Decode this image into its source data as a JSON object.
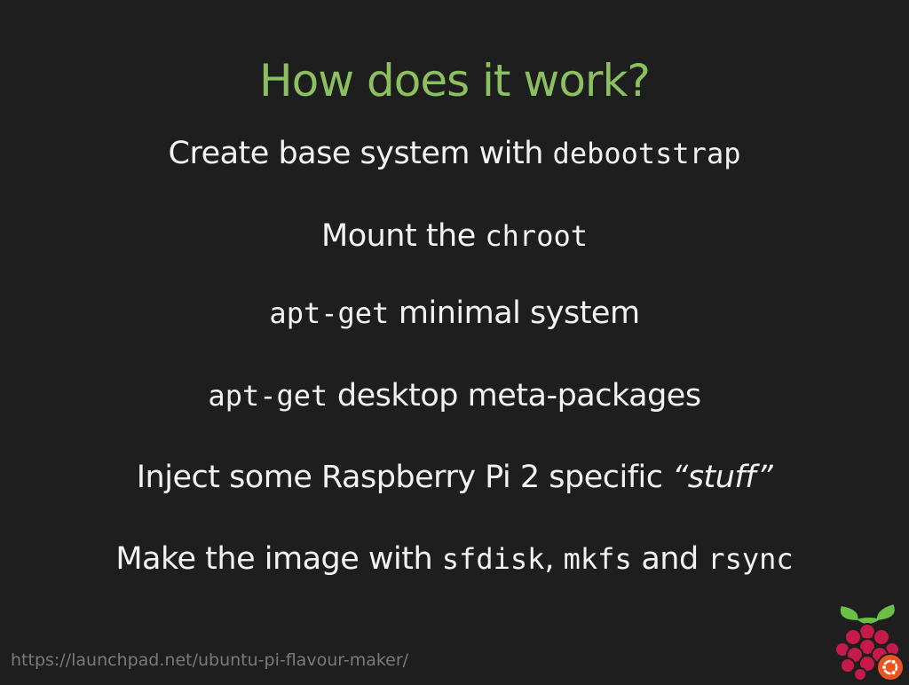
{
  "slide": {
    "title": "How does it work?",
    "lines": [
      {
        "text": "Create base system with ",
        "code": "debootstrap"
      },
      {
        "text": "Mount the ",
        "code": "chroot"
      },
      {
        "code": "apt-get",
        "text": " minimal system"
      },
      {
        "code": "apt-get",
        "text": " desktop meta-packages"
      },
      {
        "text": "Inject some Raspberry Pi 2 specific ",
        "quote": "“stuff”"
      },
      {
        "text": "Make the image with ",
        "code1": "sfdisk",
        "sep1": ", ",
        "code2": "mkfs",
        "sep2": " and ",
        "code3": "rsync"
      }
    ],
    "footer_url": "https://launchpad.net/ubuntu-pi-flavour-maker/",
    "logo_icon": "raspberry-ubuntu-logo-icon"
  },
  "colors": {
    "background": "#1e1e1e",
    "title": "#8bbf5f",
    "text": "#f2f2f2",
    "footer": "#7a7a7a"
  }
}
